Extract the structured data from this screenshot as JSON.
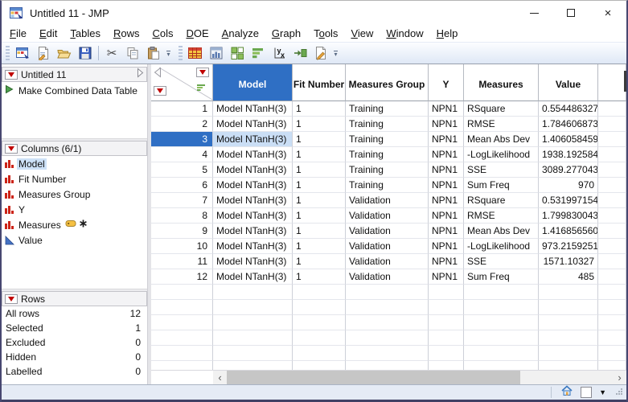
{
  "window": {
    "title": "Untitled 11 - JMP"
  },
  "menu": {
    "items": [
      {
        "label": "File",
        "underline": 0
      },
      {
        "label": "Edit",
        "underline": 0
      },
      {
        "label": "Tables",
        "underline": 0
      },
      {
        "label": "Rows",
        "underline": 0
      },
      {
        "label": "Cols",
        "underline": 0
      },
      {
        "label": "DOE",
        "underline": 0
      },
      {
        "label": "Analyze",
        "underline": 0
      },
      {
        "label": "Graph",
        "underline": 0
      },
      {
        "label": "Tools",
        "underline": 1
      },
      {
        "label": "View",
        "underline": 0
      },
      {
        "label": "Window",
        "underline": 0
      },
      {
        "label": "Help",
        "underline": 0
      }
    ]
  },
  "toolbar": {
    "groups": [
      {
        "icons": [
          "new-data-table-icon",
          "new-journal-icon",
          "open-icon",
          "save-icon",
          "separator",
          "cut-icon",
          "copy-icon",
          "paste-icon"
        ]
      },
      {
        "icons": [
          "data-table-icon",
          "distribution-icon",
          "fit-y-by-x-icon",
          "graph-builder-icon",
          "fit-model-icon",
          "formula-icon",
          "script-editor-icon"
        ]
      }
    ]
  },
  "sidebar": {
    "table_panel": {
      "title": "Untitled 11",
      "items": [
        {
          "label": "Make Combined Data Table",
          "icon": "green-play-icon"
        }
      ]
    },
    "columns_panel": {
      "title": "Columns (6/1)",
      "items": [
        {
          "label": "Model",
          "type_icon": "nominal-icon",
          "selected": true
        },
        {
          "label": "Fit Number",
          "type_icon": "nominal-icon",
          "selected": false
        },
        {
          "label": "Measures Group",
          "type_icon": "nominal-icon",
          "selected": false
        },
        {
          "label": "Y",
          "type_icon": "nominal-icon",
          "selected": false
        },
        {
          "label": "Measures",
          "type_icon": "nominal-icon",
          "selected": false,
          "badges": [
            "label-tag-icon",
            "asterisk-icon"
          ]
        },
        {
          "label": "Value",
          "type_icon": "continuous-icon",
          "selected": false
        }
      ]
    },
    "rows_panel": {
      "title": "Rows",
      "stats": [
        {
          "label": "All rows",
          "value": "12"
        },
        {
          "label": "Selected",
          "value": "1"
        },
        {
          "label": "Excluded",
          "value": "0"
        },
        {
          "label": "Hidden",
          "value": "0"
        },
        {
          "label": "Labelled",
          "value": "0"
        }
      ]
    }
  },
  "table": {
    "columns": [
      "Model",
      "Fit Number",
      "Measures Group",
      "Y",
      "Measures",
      "Value"
    ],
    "selected_column": "Model",
    "selected_row": 3,
    "rows": [
      [
        "1",
        "Model NTanH(3)",
        "1",
        "Training",
        "NPN1",
        "RSquare",
        "0.5544863273"
      ],
      [
        "2",
        "Model NTanH(3)",
        "1",
        "Training",
        "NPN1",
        "RMSE",
        "1.7846068738"
      ],
      [
        "3",
        "Model NTanH(3)",
        "1",
        "Training",
        "NPN1",
        "Mean Abs Dev",
        "1.4060584594"
      ],
      [
        "4",
        "Model NTanH(3)",
        "1",
        "Training",
        "NPN1",
        "-LogLikelihood",
        "1938.1925849"
      ],
      [
        "5",
        "Model NTanH(3)",
        "1",
        "Training",
        "NPN1",
        "SSE",
        "3089.2770433"
      ],
      [
        "6",
        "Model NTanH(3)",
        "1",
        "Training",
        "NPN1",
        "Sum Freq",
        "970"
      ],
      [
        "7",
        "Model NTanH(3)",
        "1",
        "Validation",
        "NPN1",
        "RSquare",
        "0.5319971546"
      ],
      [
        "8",
        "Model NTanH(3)",
        "1",
        "Validation",
        "NPN1",
        "RMSE",
        "1.7998300435"
      ],
      [
        "9",
        "Model NTanH(3)",
        "1",
        "Validation",
        "NPN1",
        "Mean Abs Dev",
        "1.4168565606"
      ],
      [
        "10",
        "Model NTanH(3)",
        "1",
        "Validation",
        "NPN1",
        "-LogLikelihood",
        "973.2159251"
      ],
      [
        "11",
        "Model NTanH(3)",
        "1",
        "Validation",
        "NPN1",
        "SSE",
        "1571.10327"
      ],
      [
        "12",
        "Model NTanH(3)",
        "1",
        "Validation",
        "NPN1",
        "Sum Freq",
        "485"
      ]
    ]
  },
  "colors": {
    "accent_blue": "#2f6fc4",
    "selection_light": "#cadef5",
    "red_triangle": "#c00200",
    "green_play": "#3c8c3c"
  }
}
